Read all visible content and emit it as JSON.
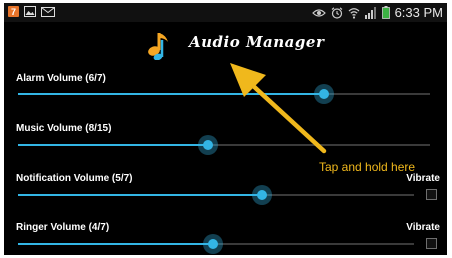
{
  "status_bar": {
    "time": "6:33 PM",
    "left_icons": [
      "app-notification-icon",
      "image-icon",
      "mail-icon"
    ],
    "right_icons": [
      "eye-icon",
      "alarm-icon",
      "wifi-icon",
      "signal-icon",
      "battery-icon"
    ],
    "accent": "#3cb043"
  },
  "app": {
    "title": "Audio Manager",
    "icon": "music-note-icon"
  },
  "controls": [
    {
      "label": "Alarm Volume (6/7)",
      "value": 6,
      "max": 7,
      "vibrate_label": ""
    },
    {
      "label": "Music Volume (8/15)",
      "value": 8,
      "max": 15,
      "vibrate_label": ""
    },
    {
      "label": "Notification Volume (5/7)",
      "value": 5,
      "max": 7,
      "vibrate_label": "Vibrate",
      "vibrate_checked": false
    },
    {
      "label": "Ringer Volume (4/7)",
      "value": 4,
      "max": 7,
      "vibrate_label": "Vibrate",
      "vibrate_checked": false
    }
  ],
  "annotation": {
    "text": "Tap and hold here",
    "color": "#f0b81c"
  },
  "colors": {
    "slider_accent": "#33b5e5",
    "background": "#000000"
  }
}
